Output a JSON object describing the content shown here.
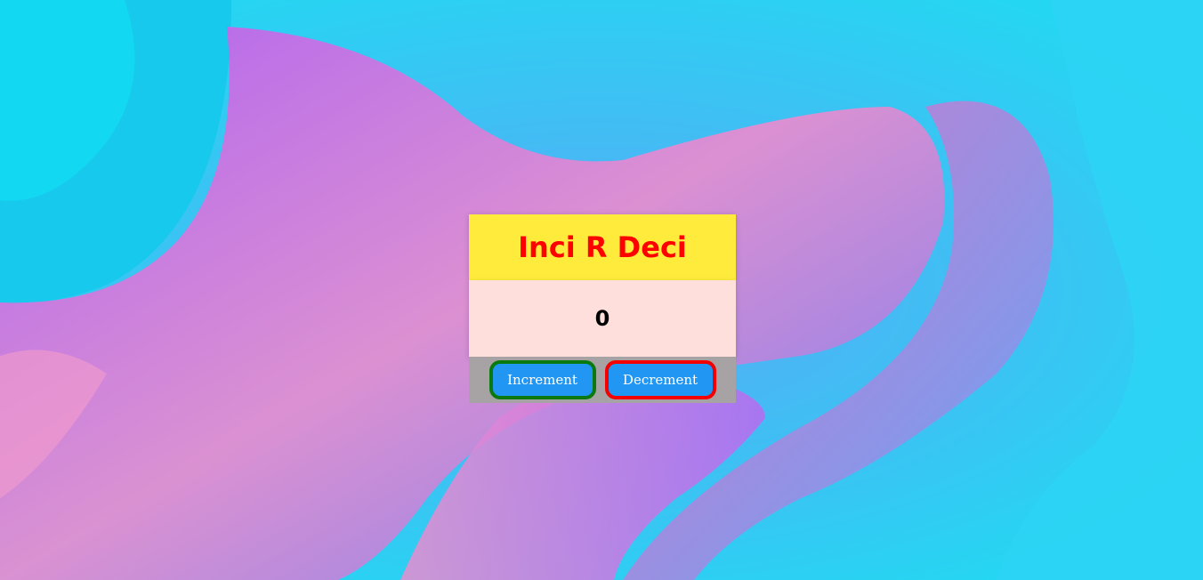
{
  "app": {
    "title": "Inci R Deci",
    "counter_value": "0"
  },
  "buttons": {
    "increment_label": "Increment",
    "decrement_label": "Decrement"
  },
  "colors": {
    "header_bg": "#ffeb3b",
    "title_text": "#ff0000",
    "body_bg": "#ffdfdc",
    "footer_bg": "#a7a2a3",
    "button_bg": "#2196f3",
    "increment_border": "#0a7a10",
    "decrement_border": "#f40000"
  }
}
